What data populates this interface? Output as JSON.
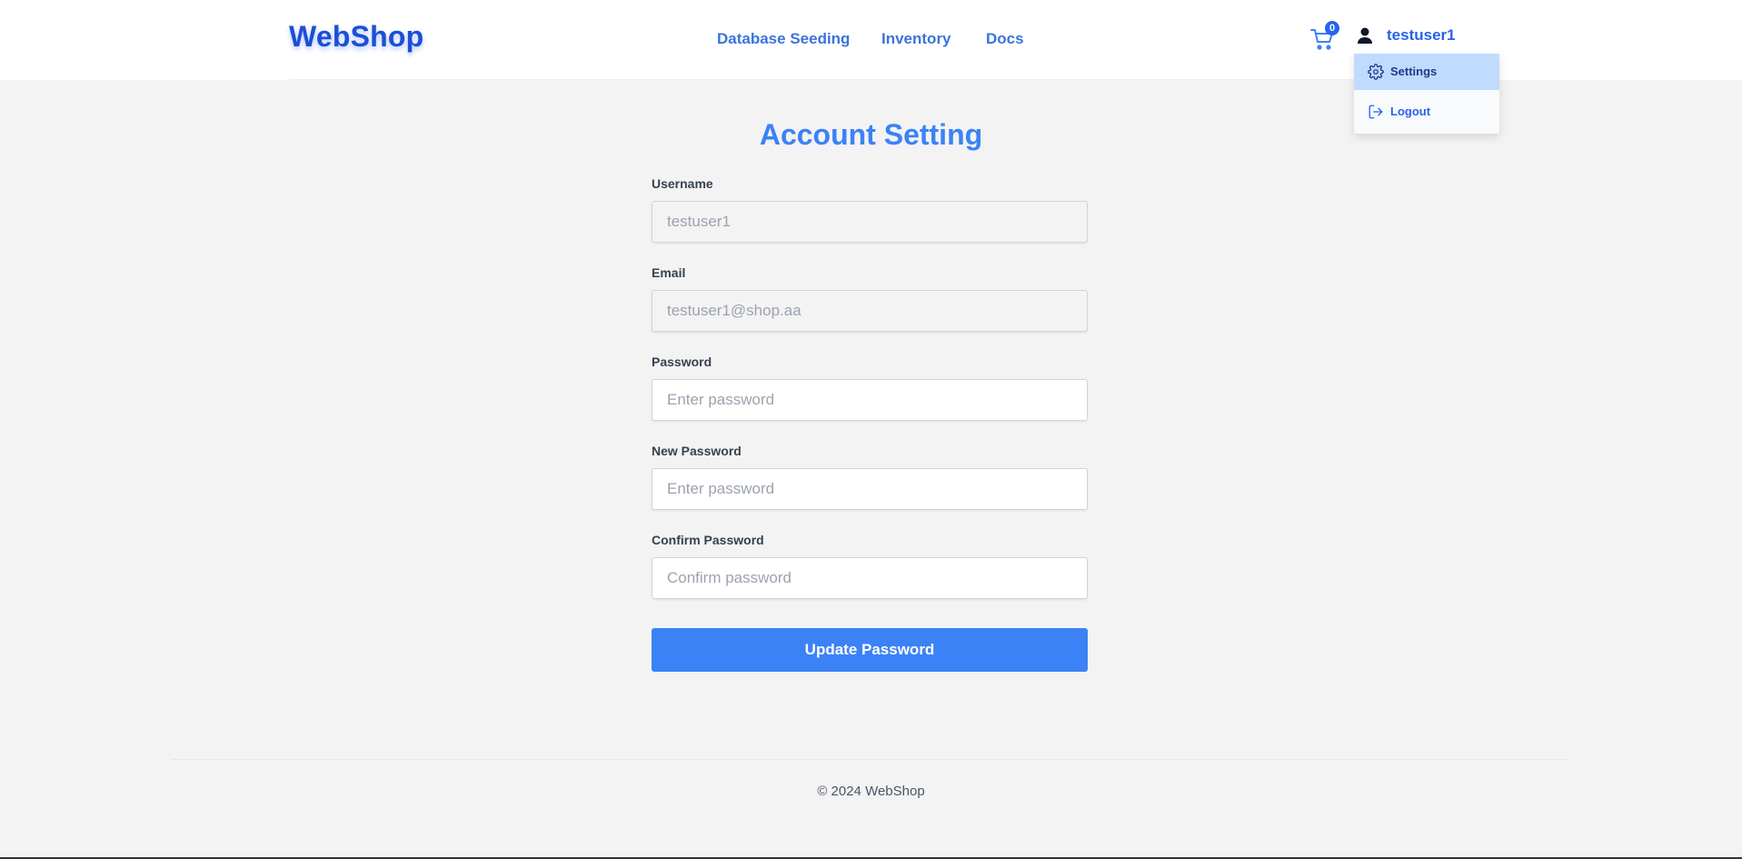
{
  "header": {
    "logo": "WebShop",
    "nav": [
      {
        "label": "Database Seeding"
      },
      {
        "label": "Inventory"
      },
      {
        "label": "Docs"
      }
    ],
    "cart_count": "0",
    "username": "testuser1"
  },
  "dropdown": {
    "items": [
      {
        "label": "Settings",
        "icon": "gear-icon",
        "active": true
      },
      {
        "label": "Logout",
        "icon": "logout-icon",
        "active": false
      }
    ]
  },
  "form": {
    "title": "Account Setting",
    "fields": [
      {
        "label": "Username",
        "value": "testuser1",
        "placeholder": "",
        "disabled": true
      },
      {
        "label": "Email",
        "value": "testuser1@shop.aa",
        "placeholder": "",
        "disabled": true
      },
      {
        "label": "Password",
        "value": "",
        "placeholder": "Enter password",
        "disabled": false
      },
      {
        "label": "New Password",
        "value": "",
        "placeholder": "Enter password",
        "disabled": false
      },
      {
        "label": "Confirm Password",
        "value": "",
        "placeholder": "Confirm password",
        "disabled": false
      }
    ],
    "submit_label": "Update Password"
  },
  "footer": {
    "text": "© 2024 WebShop"
  },
  "colors": {
    "primary": "#3b82f6",
    "brand": "#1d4ed8",
    "active_menu": "#bfdbfe",
    "background": "#f3f3f3"
  }
}
